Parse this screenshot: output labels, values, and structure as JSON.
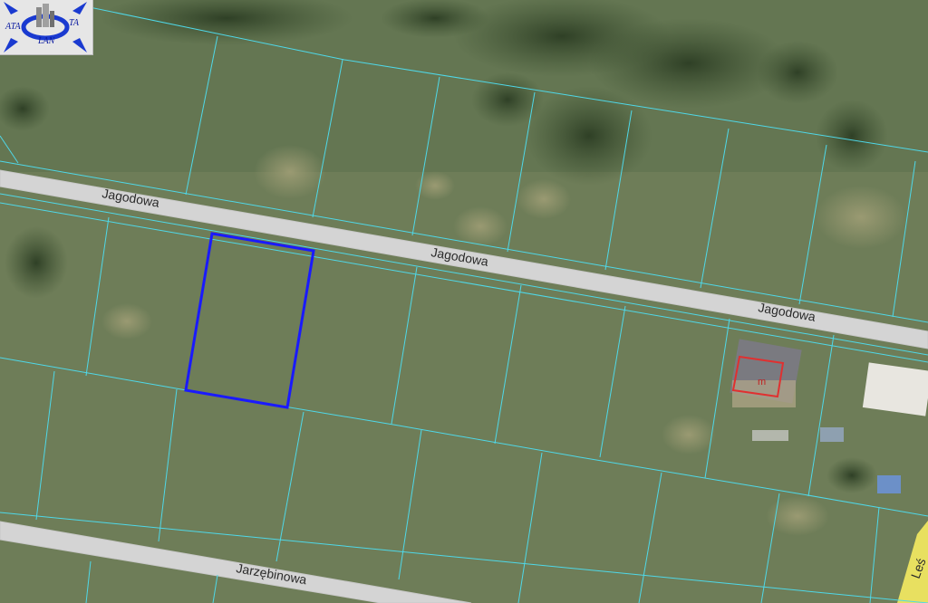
{
  "logo": {
    "left_text": "ATA",
    "right_text": "TA",
    "bottom_text": "LAN"
  },
  "streets": {
    "jagodowa_1": "Jagodowa",
    "jagodowa_2": "Jagodowa",
    "jagodowa_3": "Jagodowa",
    "jarzebinowa": "Jarzębinowa",
    "lesna_partial": "Leś"
  },
  "building_marker": "m",
  "colors": {
    "parcel_lines": "#4fd8e8",
    "selected_parcel": "#1a1aff",
    "building_outline": "#e03030",
    "road": "#d9d9d9",
    "road_yellow": "#f0e000"
  }
}
